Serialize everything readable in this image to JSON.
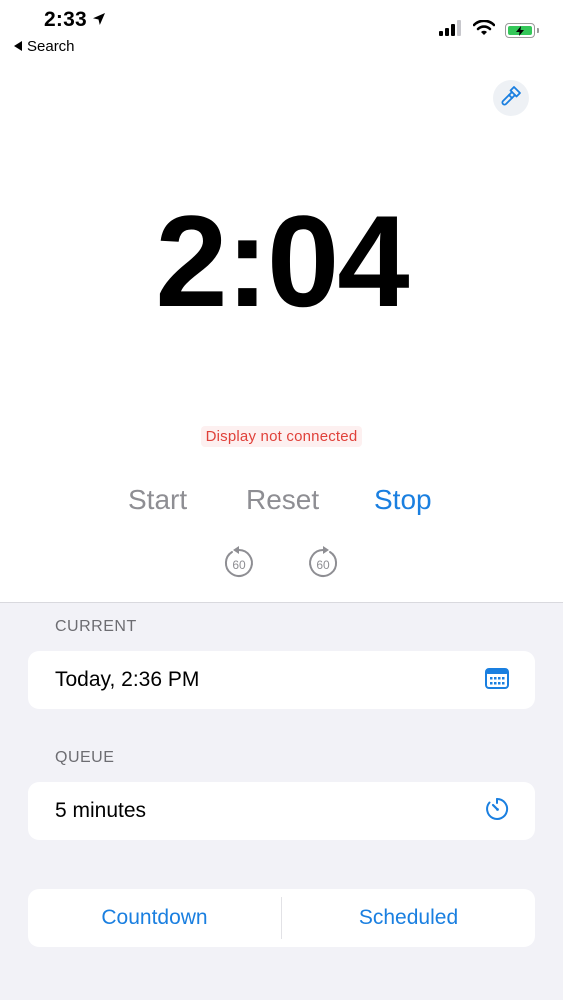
{
  "status_bar": {
    "time": "2:33",
    "back_label": "Search"
  },
  "timer": {
    "display": "2:04",
    "connection_status": "Display not connected"
  },
  "controls": {
    "start": "Start",
    "reset": "Reset",
    "stop": "Stop",
    "skip_back_seconds": "60",
    "skip_forward_seconds": "60"
  },
  "current": {
    "header": "CURRENT",
    "value": "Today, 2:36 PM"
  },
  "queue": {
    "header": "QUEUE",
    "value": "5 minutes"
  },
  "modes": {
    "countdown": "Countdown",
    "scheduled": "Scheduled"
  },
  "colors": {
    "accent": "#1a7fe0",
    "disabled": "#8e8e93",
    "warning": "#e0413a",
    "grouped_background": "#f2f2f7"
  },
  "icons": {
    "location": "location-arrow-icon",
    "back": "back-triangle-icon",
    "cellular": "cellular-signal-icon",
    "wifi": "wifi-icon",
    "battery": "battery-charging-icon",
    "brush": "paintbrush-icon",
    "calendar": "calendar-icon",
    "timer": "timer-icon"
  }
}
